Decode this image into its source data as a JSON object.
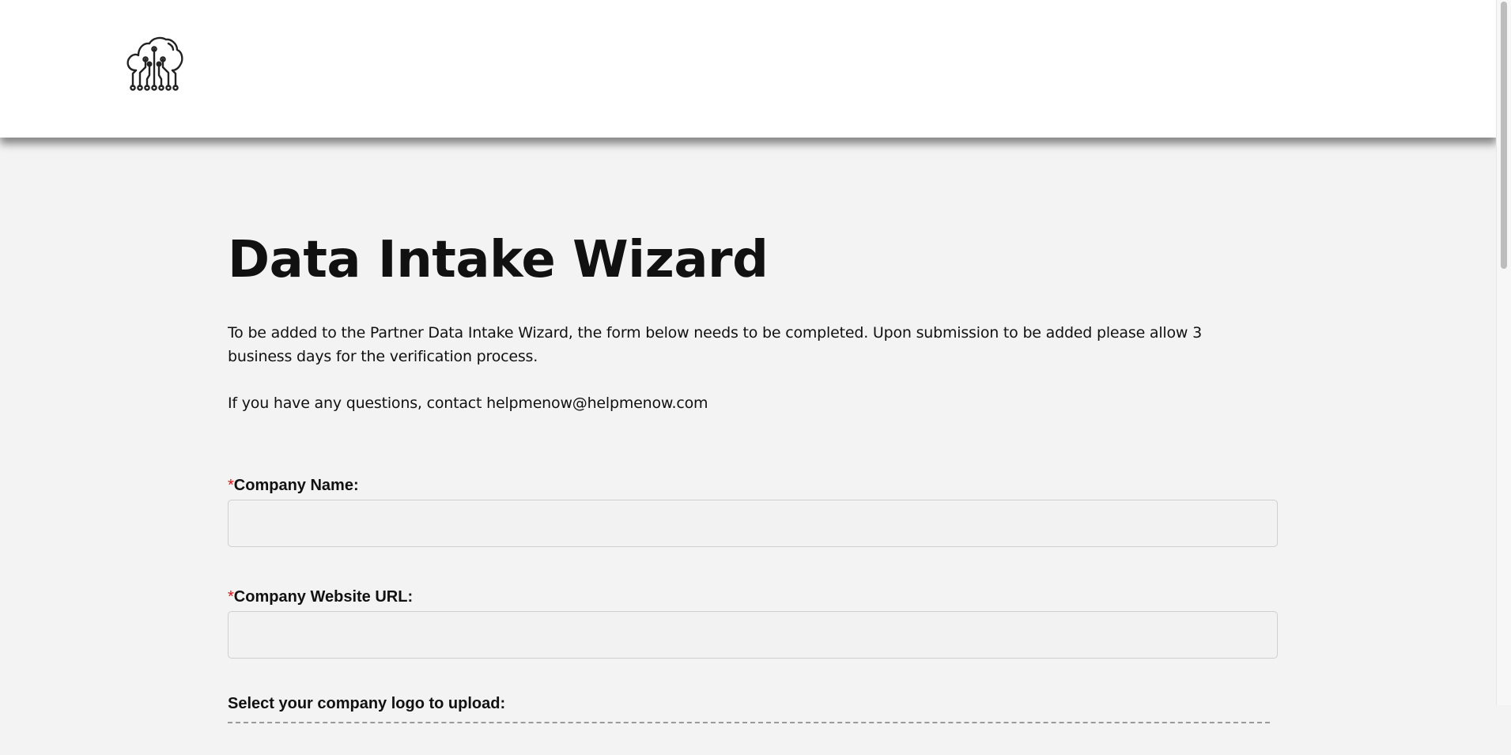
{
  "header": {
    "logo_icon": "cloud-circuit-icon"
  },
  "main": {
    "title": "Data Intake Wizard",
    "intro": "To be added to the Partner Data Intake Wizard, the form below needs to be completed. Upon submission to be added please allow 3 business days for the verification process.",
    "contact": "If you have any questions, contact helpmenow@helpmenow.com"
  },
  "form": {
    "required_marker": "*",
    "company_name": {
      "label": "Company Name:",
      "value": ""
    },
    "company_website": {
      "label": "Company Website URL:",
      "value": ""
    },
    "logo_upload": {
      "label": "Select your company logo to upload:"
    }
  }
}
